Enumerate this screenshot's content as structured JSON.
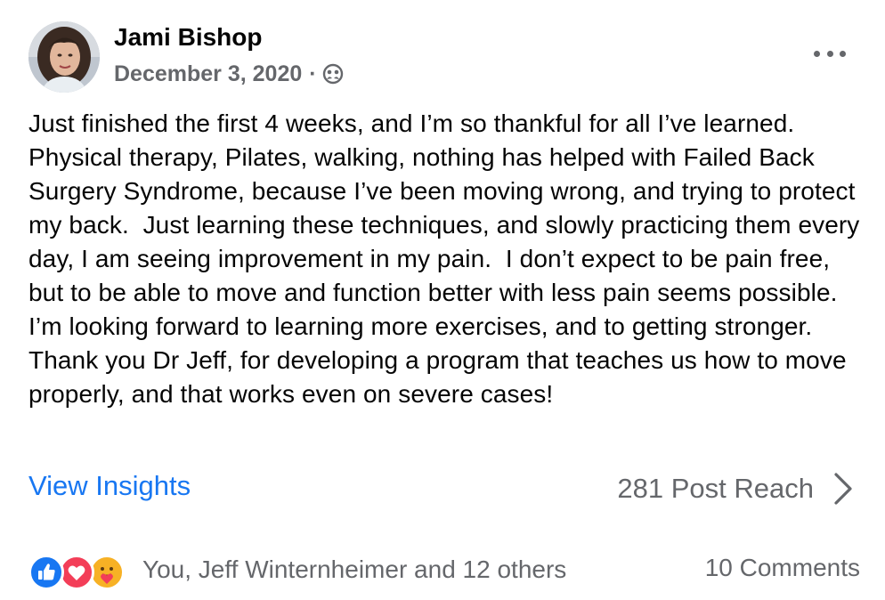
{
  "post": {
    "author": "Jami Bishop",
    "date": "December 3, 2020",
    "separator": "·",
    "audience_icon": "friends-audience-icon",
    "more_icon": "more-options-icon",
    "body": "Just finished the first 4 weeks, and I’m so thankful for all I’ve learned.  Physical therapy, Pilates, walking, nothing has helped with Failed Back Surgery Syndrome, because I’ve been moving wrong, and trying to protect my back.  Just learning these techniques, and slowly practicing them every day, I am seeing improvement in my pain.  I don’t expect to be pain free, but to be able to move and function better with less pain seems possible.  I’m looking forward to learning more exercises, and to getting stronger.  Thank you Dr Jeff, for developing a program that teaches us how to move properly, and that works even on severe cases!"
  },
  "insights": {
    "link_label": "View Insights",
    "reach_text": "281 Post Reach",
    "chevron_icon": "chevron-right-icon"
  },
  "footer": {
    "reaction_icons": [
      "like-icon",
      "love-icon",
      "care-icon"
    ],
    "reaction_summary": "You, Jeff Winternheimer and 12 others",
    "comments_label": "10 Comments"
  },
  "colors": {
    "link": "#1877f2",
    "secondary_text": "#65676b",
    "primary_text": "#050505",
    "like": "#1877f2",
    "love": "#f33e58",
    "care": "#f7b125"
  }
}
